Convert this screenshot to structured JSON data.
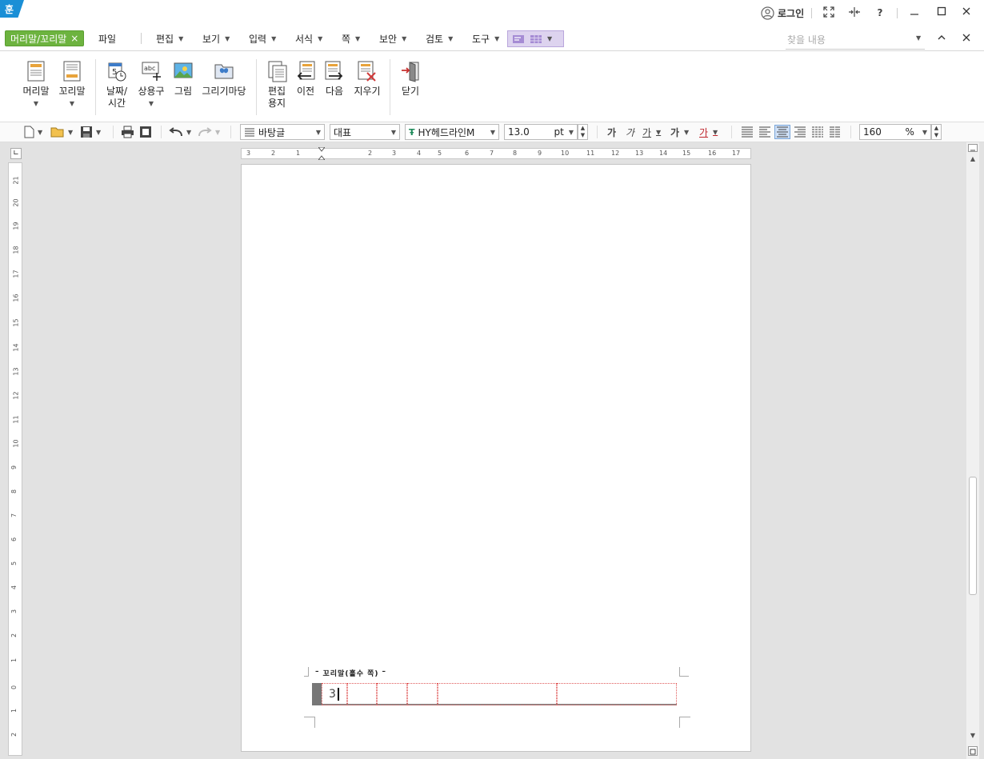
{
  "app": {
    "logo_text": "훈"
  },
  "titlebar": {
    "login_label": "로그인"
  },
  "context_tab": {
    "label": "머리말/꼬리말",
    "close": "×"
  },
  "menus": [
    "파일",
    "편집",
    "보기",
    "입력",
    "서식",
    "쪽",
    "보안",
    "검토",
    "도구"
  ],
  "search": {
    "placeholder": "찾을 내용"
  },
  "ribbon": {
    "header": "머리말",
    "footer": "꼬리말",
    "datetime_l1": "날짜/",
    "datetime_l2": "시간",
    "phrases": "상용구",
    "image": "그림",
    "drawing": "그리기마당",
    "edit_l1": "편집",
    "edit_l2": "용지",
    "prev": "이전",
    "next": "다음",
    "delete": "지우기",
    "close": "닫기"
  },
  "toolbar": {
    "style": "바탕글",
    "language": "대표",
    "font": "HY헤드라인M",
    "font_size": "13.0",
    "size_unit": "pt",
    "zoom": "160",
    "zoom_unit": "%"
  },
  "hruler_ticks": [
    "3",
    "2",
    "1",
    "1",
    "2",
    "3",
    "4",
    "5",
    "6",
    "7",
    "8",
    "9",
    "10",
    "11",
    "12",
    "13",
    "14",
    "15",
    "16",
    "17"
  ],
  "vruler_ticks": [
    "21",
    "20",
    "19",
    "18",
    "17",
    "16",
    "15",
    "14",
    "13",
    "12",
    "11",
    "10",
    "9",
    "8",
    "7",
    "6",
    "5",
    "4",
    "3",
    "2",
    "1",
    "0",
    "1",
    "2"
  ],
  "footer_area": {
    "label": "꼬리말(홀수 쪽)",
    "page_number": "3"
  }
}
